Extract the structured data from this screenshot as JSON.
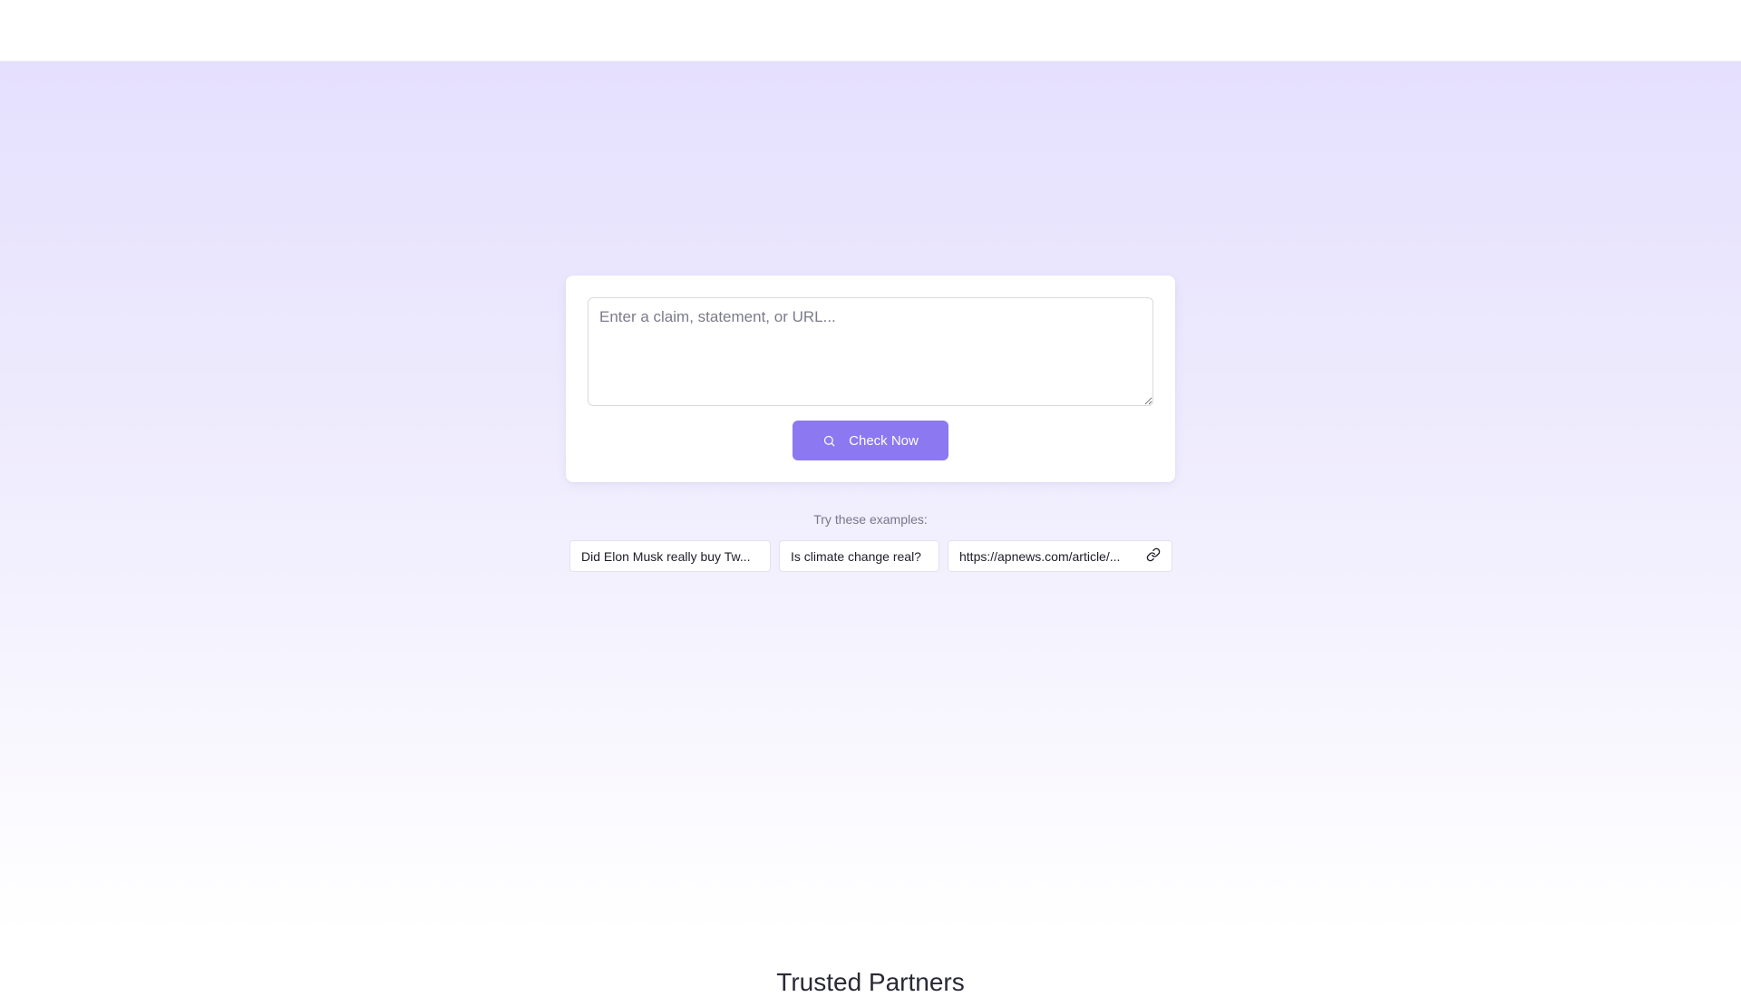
{
  "search": {
    "placeholder": "Enter a claim, statement, or URL...",
    "value": "",
    "button_label": "Check Now",
    "button_icon": "search-icon"
  },
  "examples": {
    "label": "Try these examples:",
    "items": [
      {
        "label": "Did Elon Musk really buy Tw...",
        "icon": ""
      },
      {
        "label": "Is climate change real?",
        "icon": ""
      },
      {
        "label": "https://apnews.com/article/...",
        "icon": "link-icon"
      }
    ]
  },
  "next_section": {
    "title": "Trusted Partners"
  },
  "colors": {
    "accent": "#8c78f0",
    "hero_top": "#e5e0fe",
    "hero_bottom": "#ffffff"
  }
}
